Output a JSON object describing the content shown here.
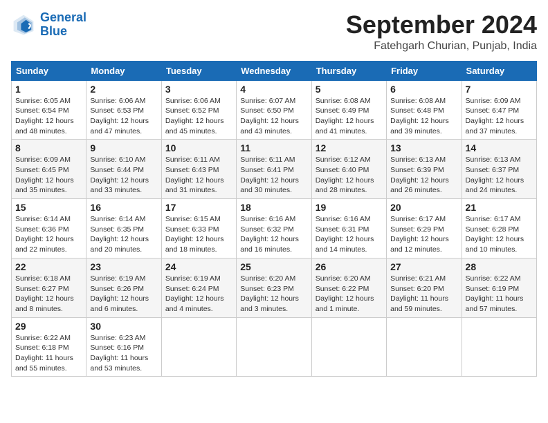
{
  "logo": {
    "line1": "General",
    "line2": "Blue"
  },
  "title": "September 2024",
  "subtitle": "Fatehgarh Churian, Punjab, India",
  "headers": [
    "Sunday",
    "Monday",
    "Tuesday",
    "Wednesday",
    "Thursday",
    "Friday",
    "Saturday"
  ],
  "weeks": [
    [
      {
        "day": "1",
        "info": "Sunrise: 6:05 AM\nSunset: 6:54 PM\nDaylight: 12 hours\nand 48 minutes."
      },
      {
        "day": "2",
        "info": "Sunrise: 6:06 AM\nSunset: 6:53 PM\nDaylight: 12 hours\nand 47 minutes."
      },
      {
        "day": "3",
        "info": "Sunrise: 6:06 AM\nSunset: 6:52 PM\nDaylight: 12 hours\nand 45 minutes."
      },
      {
        "day": "4",
        "info": "Sunrise: 6:07 AM\nSunset: 6:50 PM\nDaylight: 12 hours\nand 43 minutes."
      },
      {
        "day": "5",
        "info": "Sunrise: 6:08 AM\nSunset: 6:49 PM\nDaylight: 12 hours\nand 41 minutes."
      },
      {
        "day": "6",
        "info": "Sunrise: 6:08 AM\nSunset: 6:48 PM\nDaylight: 12 hours\nand 39 minutes."
      },
      {
        "day": "7",
        "info": "Sunrise: 6:09 AM\nSunset: 6:47 PM\nDaylight: 12 hours\nand 37 minutes."
      }
    ],
    [
      {
        "day": "8",
        "info": "Sunrise: 6:09 AM\nSunset: 6:45 PM\nDaylight: 12 hours\nand 35 minutes."
      },
      {
        "day": "9",
        "info": "Sunrise: 6:10 AM\nSunset: 6:44 PM\nDaylight: 12 hours\nand 33 minutes."
      },
      {
        "day": "10",
        "info": "Sunrise: 6:11 AM\nSunset: 6:43 PM\nDaylight: 12 hours\nand 31 minutes."
      },
      {
        "day": "11",
        "info": "Sunrise: 6:11 AM\nSunset: 6:41 PM\nDaylight: 12 hours\nand 30 minutes."
      },
      {
        "day": "12",
        "info": "Sunrise: 6:12 AM\nSunset: 6:40 PM\nDaylight: 12 hours\nand 28 minutes."
      },
      {
        "day": "13",
        "info": "Sunrise: 6:13 AM\nSunset: 6:39 PM\nDaylight: 12 hours\nand 26 minutes."
      },
      {
        "day": "14",
        "info": "Sunrise: 6:13 AM\nSunset: 6:37 PM\nDaylight: 12 hours\nand 24 minutes."
      }
    ],
    [
      {
        "day": "15",
        "info": "Sunrise: 6:14 AM\nSunset: 6:36 PM\nDaylight: 12 hours\nand 22 minutes."
      },
      {
        "day": "16",
        "info": "Sunrise: 6:14 AM\nSunset: 6:35 PM\nDaylight: 12 hours\nand 20 minutes."
      },
      {
        "day": "17",
        "info": "Sunrise: 6:15 AM\nSunset: 6:33 PM\nDaylight: 12 hours\nand 18 minutes."
      },
      {
        "day": "18",
        "info": "Sunrise: 6:16 AM\nSunset: 6:32 PM\nDaylight: 12 hours\nand 16 minutes."
      },
      {
        "day": "19",
        "info": "Sunrise: 6:16 AM\nSunset: 6:31 PM\nDaylight: 12 hours\nand 14 minutes."
      },
      {
        "day": "20",
        "info": "Sunrise: 6:17 AM\nSunset: 6:29 PM\nDaylight: 12 hours\nand 12 minutes."
      },
      {
        "day": "21",
        "info": "Sunrise: 6:17 AM\nSunset: 6:28 PM\nDaylight: 12 hours\nand 10 minutes."
      }
    ],
    [
      {
        "day": "22",
        "info": "Sunrise: 6:18 AM\nSunset: 6:27 PM\nDaylight: 12 hours\nand 8 minutes."
      },
      {
        "day": "23",
        "info": "Sunrise: 6:19 AM\nSunset: 6:26 PM\nDaylight: 12 hours\nand 6 minutes."
      },
      {
        "day": "24",
        "info": "Sunrise: 6:19 AM\nSunset: 6:24 PM\nDaylight: 12 hours\nand 4 minutes."
      },
      {
        "day": "25",
        "info": "Sunrise: 6:20 AM\nSunset: 6:23 PM\nDaylight: 12 hours\nand 3 minutes."
      },
      {
        "day": "26",
        "info": "Sunrise: 6:20 AM\nSunset: 6:22 PM\nDaylight: 12 hours\nand 1 minute."
      },
      {
        "day": "27",
        "info": "Sunrise: 6:21 AM\nSunset: 6:20 PM\nDaylight: 11 hours\nand 59 minutes."
      },
      {
        "day": "28",
        "info": "Sunrise: 6:22 AM\nSunset: 6:19 PM\nDaylight: 11 hours\nand 57 minutes."
      }
    ],
    [
      {
        "day": "29",
        "info": "Sunrise: 6:22 AM\nSunset: 6:18 PM\nDaylight: 11 hours\nand 55 minutes."
      },
      {
        "day": "30",
        "info": "Sunrise: 6:23 AM\nSunset: 6:16 PM\nDaylight: 11 hours\nand 53 minutes."
      },
      {
        "day": "",
        "info": ""
      },
      {
        "day": "",
        "info": ""
      },
      {
        "day": "",
        "info": ""
      },
      {
        "day": "",
        "info": ""
      },
      {
        "day": "",
        "info": ""
      }
    ]
  ]
}
